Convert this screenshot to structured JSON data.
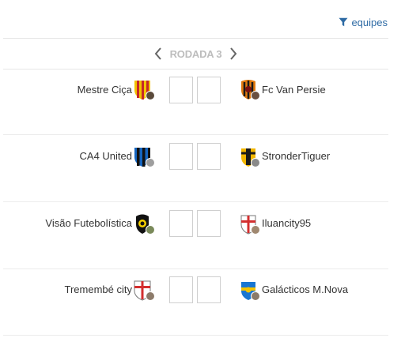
{
  "filter": {
    "label": "equipes",
    "icon": "filter-icon"
  },
  "round": {
    "label": "RODADA 3",
    "prev_icon": "chevron-left-icon",
    "next_icon": "chevron-right-icon"
  },
  "matches": [
    {
      "home": "Mestre Ciça",
      "away": "Fc Van Persie",
      "home_score": "",
      "away_score": ""
    },
    {
      "home": "CA4 United",
      "away": "StronderTiguer",
      "home_score": "",
      "away_score": ""
    },
    {
      "home": "Visão Futebolística",
      "away": "Iluancity95",
      "home_score": "",
      "away_score": ""
    },
    {
      "home": "Tremembé city",
      "away": "Galácticos M.Nova",
      "home_score": "",
      "away_score": ""
    }
  ]
}
